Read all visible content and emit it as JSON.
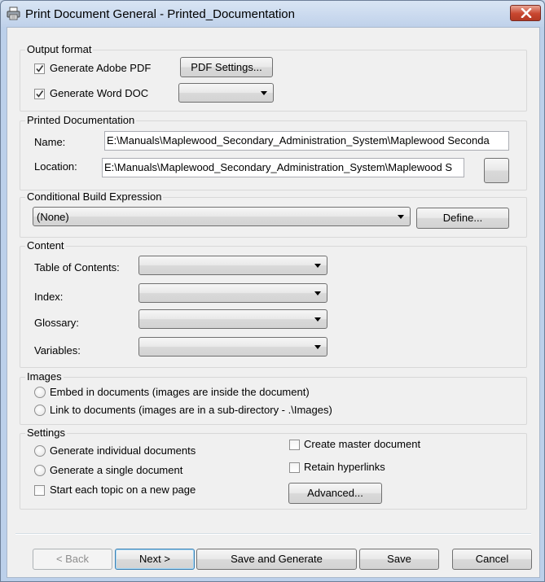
{
  "window": {
    "title": "Print Document General - Printed_Documentation"
  },
  "output_format": {
    "legend": "Output format",
    "pdf_label": "Generate Adobe PDF",
    "pdf_checked": true,
    "pdf_settings_label": "PDF Settings...",
    "word_label": "Generate Word DOC",
    "word_checked": true,
    "word_select_value": ""
  },
  "printed_doc": {
    "legend": "Printed Documentation",
    "name_label": "Name:",
    "name_value": "E:\\Manuals\\Maplewood_Secondary_Administration_System\\Maplewood Seconda",
    "location_label": "Location:",
    "location_value": "E:\\Manuals\\Maplewood_Secondary_Administration_System\\Maplewood S",
    "browse_label": ""
  },
  "conditional": {
    "legend": "Conditional Build Expression",
    "value": "(None)",
    "define_label": "Define..."
  },
  "content": {
    "legend": "Content",
    "toc_label": "Table of Contents:",
    "index_label": "Index:",
    "glossary_label": "Glossary:",
    "variables_label": "Variables:",
    "toc_value": "",
    "index_value": "",
    "glossary_value": "",
    "variables_value": ""
  },
  "images": {
    "legend": "Images",
    "embed_label": "Embed in documents (images are inside the document)",
    "link_label": "Link to documents (images are in a sub-directory - .\\Images)"
  },
  "settings": {
    "legend": "Settings",
    "individual_label": "Generate individual documents",
    "single_label": "Generate a single document",
    "new_page_label": "Start each topic on a new page",
    "master_label": "Create master document",
    "hyperlinks_label": "Retain hyperlinks",
    "advanced_label": "Advanced..."
  },
  "footer": {
    "back_label": "< Back",
    "next_label": "Next >",
    "save_generate_label": "Save and Generate",
    "save_label": "Save",
    "cancel_label": "Cancel"
  }
}
